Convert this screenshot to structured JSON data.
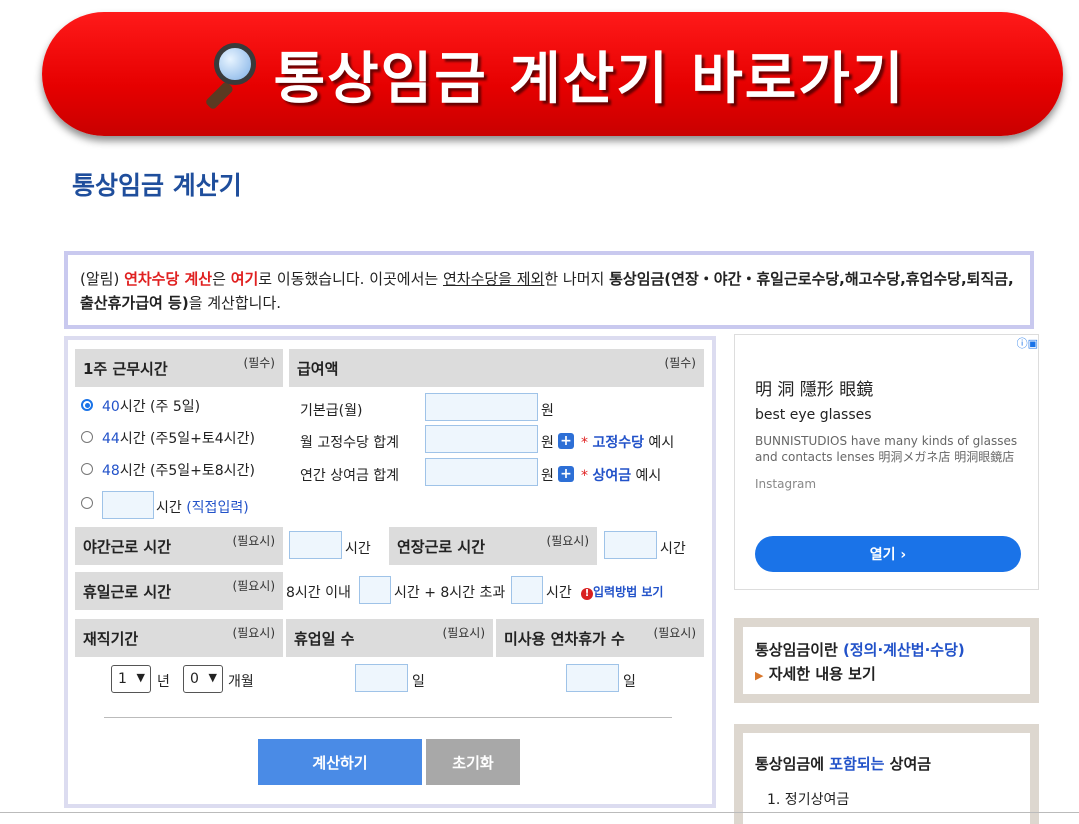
{
  "banner": {
    "text": "통상임금 계산기 바로가기",
    "icon": "magnifying-glass-icon"
  },
  "page_title": "통상임금 계산기",
  "notice": {
    "p1": "(알림) ",
    "p2": "연차수당 계산",
    "p3": "은 ",
    "p4": "여기",
    "p5": "로 이동했습니다. 이곳에서는 ",
    "p6": "연차수당을 제외",
    "p7": "한 나머지 ",
    "p8": "통상임금(연장・야간・휴일근로수당,해고수당,휴업수당,퇴직금,출산휴가급여 등)",
    "p9": "을 계산합니다."
  },
  "calc": {
    "weekly": {
      "title": "1주 근무시간",
      "req": "(필수)",
      "options": [
        {
          "hours": "40",
          "rest": "시간 (주 5일)",
          "selected": true
        },
        {
          "hours": "44",
          "rest": "시간 (주5일+토4시간)",
          "selected": false
        },
        {
          "hours": "48",
          "rest": "시간 (주5일+토8시간)",
          "selected": false
        }
      ],
      "direct_unit": "시간 ",
      "direct_link": "(직접입력)"
    },
    "pay": {
      "title": "급여액",
      "req": "(필수)",
      "base_label": "기본급(월)",
      "fixed_label": "월 고정수당 합계",
      "bonus_label": "연간 상여금 합계",
      "won": "원",
      "star": "* ",
      "fixed_link": "고정수당",
      "bonus_link": "상여금",
      "example": " 예시"
    },
    "night": {
      "title": "야간근로 시간",
      "req": "(필요시)",
      "unit": "시간"
    },
    "overtime": {
      "title": "연장근로 시간",
      "req": "(필요시)",
      "unit": "시간"
    },
    "holiday": {
      "title": "휴일근로 시간",
      "req": "(필요시)",
      "within": "8시간 이내",
      "unit_over": "시간 + 8시간 초과",
      "unit": "시간",
      "help_link": "입력방법 보기"
    },
    "tenure": {
      "title": "재직기간",
      "req": "(필요시)",
      "years": "1",
      "years_unit": "년",
      "months": "0",
      "months_unit": "개월"
    },
    "leave_days": {
      "title": "휴업일 수",
      "req": "(필요시)",
      "unit": "일"
    },
    "unused": {
      "title": "미사용 연차휴가 수",
      "req": "(필요시)",
      "unit": "일"
    },
    "calc_button": "계산하기",
    "reset_button": "초기화",
    "calc_color": "#4a8be6",
    "reset_color": "#a8a8a8"
  },
  "ad": {
    "title": "明 洞 隱形 眼鏡",
    "subtitle": "best eye glasses",
    "desc": "BUNNISTUDIOS have many kinds of glasses and contacts lenses 明洞メガネ店 明洞眼鏡店",
    "source": "Instagram",
    "open_button": "열기 ›"
  },
  "side1": {
    "q": "통상임금이란 ",
    "q_blue": "(정의·계산법·수당)",
    "link": "자세한 내용 보기"
  },
  "side2": {
    "t1": "통상임금에 ",
    "t_blue": "포함되는",
    "t2": " 상여금",
    "item1": "1. 정기상여금"
  }
}
